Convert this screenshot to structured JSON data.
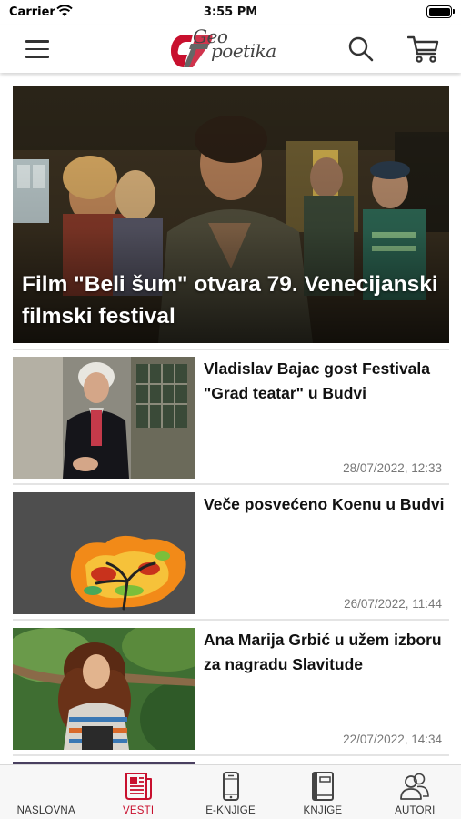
{
  "status_bar": {
    "carrier": "Carrier",
    "time": "3:55 PM"
  },
  "header": {
    "logo_line1": "Geo",
    "logo_line2": "poetika",
    "icons": {
      "menu": "hamburger-menu-icon",
      "search": "search-icon",
      "cart": "shopping-cart-icon"
    }
  },
  "hero": {
    "title": "Film \"Beli šum\" otvara 79. Venecijanski filmski festival",
    "image": "film-still-photo"
  },
  "articles": [
    {
      "title": "Vladislav Bajac gost Festivala \"Grad teatar\" u Budvi",
      "date": "28/07/2022, 12:33",
      "image": "author-portrait-photo"
    },
    {
      "title": "Veče posvećeno Koenu u Budvi",
      "date": "26/07/2022, 11:44",
      "image": "tree-painting-illustration"
    },
    {
      "title": "Ana Marija Grbić u užem izboru za nagradu Slavitude",
      "date": "22/07/2022, 14:34",
      "image": "author-portrait-photo"
    }
  ],
  "tabs": [
    {
      "label": "NASLOVNA",
      "icon": "home-icon",
      "active": false
    },
    {
      "label": "VESTI",
      "icon": "newspaper-icon",
      "active": true
    },
    {
      "label": "E-KNJIGE",
      "icon": "phone-ebook-icon",
      "active": false
    },
    {
      "label": "KNJIGE",
      "icon": "book-icon",
      "active": false
    },
    {
      "label": "AUTORI",
      "icon": "authors-icon",
      "active": false
    }
  ],
  "colors": {
    "accent": "#c8102e",
    "text": "#111111",
    "muted": "#777777",
    "tab_bar_bg": "#f7f7f7"
  }
}
